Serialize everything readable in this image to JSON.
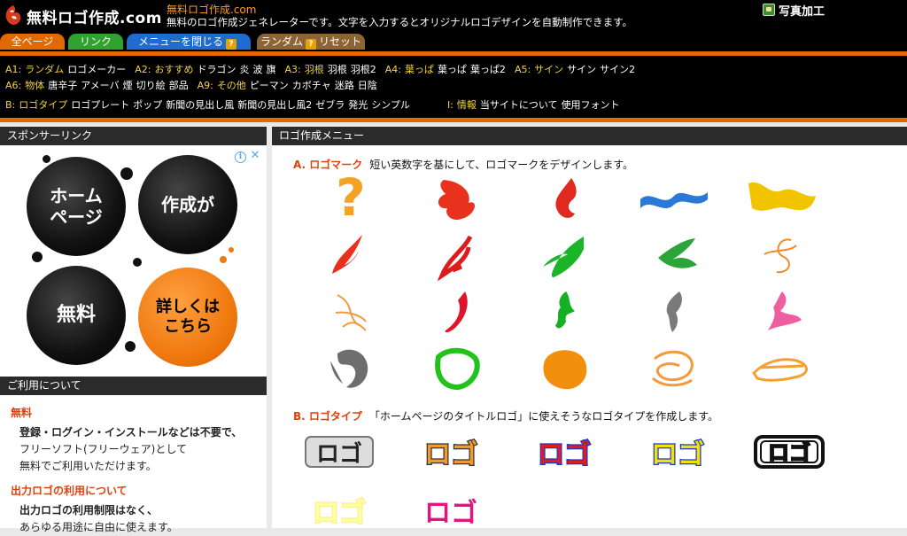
{
  "header": {
    "logo_text": "無料ロゴ作成.com",
    "site_link": "無料ロゴ作成.com",
    "site_desc": "無料のロゴ作成ジェネレーターです。文字を入力するとオリジナルロゴデザインを自動制作できます。",
    "photo_link": "写真加工"
  },
  "tabs": {
    "all": "全ページ",
    "link": "リンク",
    "close_menu": "メニューを閉じる",
    "random": "ランダム",
    "reset": "リセット",
    "help_badge": "?"
  },
  "menu": {
    "row1": [
      {
        "key": "A1",
        "items": [
          "ランダム",
          "ロゴメーカー"
        ]
      },
      {
        "key": "A2",
        "items": [
          "おすすめ",
          "ドラゴン",
          "炎",
          "波",
          "旗"
        ]
      },
      {
        "key": "A3",
        "items": [
          "羽根",
          "羽根",
          "羽根2"
        ]
      },
      {
        "key": "A4",
        "items": [
          "葉っぱ",
          "葉っぱ",
          "葉っぱ2"
        ]
      },
      {
        "key": "A5",
        "items": [
          "サイン",
          "サイン",
          "サイン2"
        ]
      }
    ],
    "row2": [
      {
        "key": "A6",
        "items": [
          "物体",
          "唐辛子",
          "アメーバ",
          "煙",
          "切り絵",
          "部品"
        ]
      },
      {
        "key": "A9",
        "items": [
          "その他",
          "ピーマン",
          "カボチャ",
          "迷路",
          "日陰"
        ]
      }
    ],
    "row3": [
      {
        "key": "B",
        "items": [
          "ロゴタイプ",
          "ロゴプレート",
          "ポップ",
          "新聞の見出し風",
          "新聞の見出し風2",
          "ゼブラ",
          "発光",
          "シンプル"
        ]
      },
      {
        "key": "I",
        "items": [
          "情報",
          "当サイトについて",
          "使用フォント"
        ]
      }
    ]
  },
  "sidebar": {
    "sponsor_title": "スポンサーリンク",
    "ad": {
      "circle1": "ホーム\nページ",
      "circle2": "作成が",
      "circle3": "無料",
      "circle4": "詳しくは\nこちら"
    },
    "usage_title": "ご利用について",
    "free_title": "無料",
    "free_lines": [
      "登録・ログイン・インストールなどは不要で、",
      "フリーソフト(フリーウェア)として",
      "無料でご利用いただけます。"
    ],
    "output_title": "出力ロゴの利用について",
    "output_lines": [
      "出力ロゴの利用制限はなく、",
      "あらゆる用途に自由に使えます。"
    ]
  },
  "main": {
    "title": "ロゴ作成メニュー",
    "section_a_key": "A. ロゴマーク",
    "section_a_desc": "短い英数字を基にして、ロゴマークをデザインします。",
    "section_b_key": "B. ロゴタイプ",
    "section_b_desc": "「ホームページのタイトルロゴ」に使えそうなロゴタイプを作成します。",
    "logotype_text": "ロゴ",
    "logo_marks": [
      {
        "icon": "question-mark-icon",
        "color": "#f3a224"
      },
      {
        "icon": "dragon-icon",
        "color": "#e8321e"
      },
      {
        "icon": "flame-icon",
        "color": "#e02a1f"
      },
      {
        "icon": "wave-icon",
        "color": "#2a78d8"
      },
      {
        "icon": "flag-icon",
        "color": "#f2c400"
      },
      {
        "icon": "feather-icon",
        "color": "#e8301c"
      },
      {
        "icon": "feather-icon",
        "color": "#e01b1b"
      },
      {
        "icon": "leaf-icon",
        "color": "#1bb52a"
      },
      {
        "icon": "leaf-icon",
        "color": "#2aa53a"
      },
      {
        "icon": "signature-icon",
        "color": "#f08a2a"
      },
      {
        "icon": "signature-icon",
        "color": "#f09a45"
      },
      {
        "icon": "chili-icon",
        "color": "#e0152c"
      },
      {
        "icon": "amoeba-icon",
        "color": "#16b024"
      },
      {
        "icon": "smoke-icon",
        "color": "#7a7a7a"
      },
      {
        "icon": "cutout-icon",
        "color": "#ee5fa0"
      },
      {
        "icon": "part-icon",
        "color": "#6e6e6e"
      },
      {
        "icon": "pepper-icon",
        "color": "#22c21c"
      },
      {
        "icon": "pumpkin-icon",
        "color": "#f2900e"
      },
      {
        "icon": "maze-icon",
        "color": "#f59a3a"
      },
      {
        "icon": "shade-icon",
        "color": "#f5a035"
      }
    ],
    "logotypes": [
      {
        "name": "logotype-plate",
        "fill": "#222",
        "stroke": "#888"
      },
      {
        "name": "logotype-pop",
        "fill": "#f29a2b",
        "stroke": "#333"
      },
      {
        "name": "logotype-newspaper",
        "fill": "#e21c1c",
        "stroke": "#1f36c8"
      },
      {
        "name": "logotype-newspaper2",
        "fill": "#f2e200",
        "stroke": "#1f36c8"
      },
      {
        "name": "logotype-zebra",
        "fill": "#fff",
        "stroke": "#111"
      },
      {
        "name": "logotype-glow",
        "fill": "#ffff9a",
        "stroke": "#f7f0a0"
      },
      {
        "name": "logotype-simple",
        "fill": "#e3147a",
        "stroke": "#e3147a"
      }
    ]
  }
}
